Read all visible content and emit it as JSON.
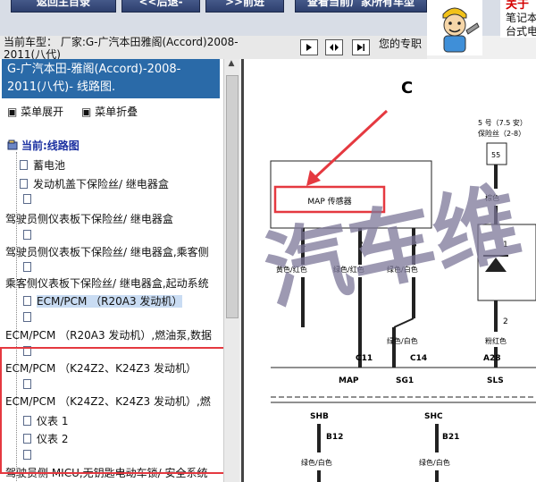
{
  "nav": {
    "buttons": [
      {
        "label": "返回主目录"
      },
      {
        "label": "<<后退-"
      },
      {
        "label": ">>前进"
      },
      {
        "label": "查看当前厂家所有车型"
      }
    ]
  },
  "promo": {
    "line1": "关于",
    "line2": "笔记本",
    "line3": "台式电"
  },
  "car": {
    "label_line1": "当前车型： 厂家:G-广汽本田雅阁(Accord)2008-",
    "label_line2": "2011(八代)",
    "my_label": "您的专职"
  },
  "panel": {
    "title": "G-广汽本田-雅阁(Accord)-2008-2011(八代)- 线路图.",
    "expand": "菜单展开",
    "collapse": "菜单折叠",
    "root": "当前:线路图"
  },
  "tree": [
    {
      "label": "蓄电池"
    },
    {
      "label": "发动机盖下保险丝/ 继电器盒"
    },
    {
      "label": "驾驶员侧仪表板下保险丝/ 继电器盒"
    },
    {
      "label": "驾驶员侧仪表板下保险丝/ 继电器盒,乘客侧"
    },
    {
      "label": "乘客侧仪表板下保险丝/ 继电器盒,起动系统"
    },
    {
      "label": "ECM/PCM （R20A3 发动机）"
    },
    {
      "label": "ECM/PCM （R20A3 发动机）,燃油泵,数据"
    },
    {
      "label": "ECM/PCM （K24Z2、K24Z3 发动机）"
    },
    {
      "label": "ECM/PCM （K24Z2、K24Z3 发动机）,燃"
    },
    {
      "label": "仪表 1"
    },
    {
      "label": "仪表 2"
    },
    {
      "label": "驾驶员侧 MICU,无钥匙电动车锁/ 安全系统"
    }
  ],
  "diagram": {
    "title": "C",
    "sensor": "MAP 传感器",
    "fuse": "5 号（7.5 安）",
    "fuse_box": "保险丝（2-8）",
    "fuse_pin": "55",
    "pins": [
      "1",
      "2",
      "3",
      "1",
      "2"
    ],
    "wire_labels": [
      "黄色/红色",
      "绿色/红色",
      "绿色/白色",
      "棕色",
      "粉红色",
      "绿色/白色",
      "绿色/白色"
    ],
    "connectors": [
      "C11",
      "C14",
      "A28",
      "B12",
      "B21"
    ],
    "signals": [
      "MAP",
      "SG1",
      "SLS",
      "SHB",
      "SHC"
    ],
    "watermark": "汽车维"
  },
  "colors": {
    "nav_button": "#3b4f86",
    "header_bg": "#2a6aa8",
    "highlight": "#e53940",
    "watermark": "#7d7899"
  }
}
